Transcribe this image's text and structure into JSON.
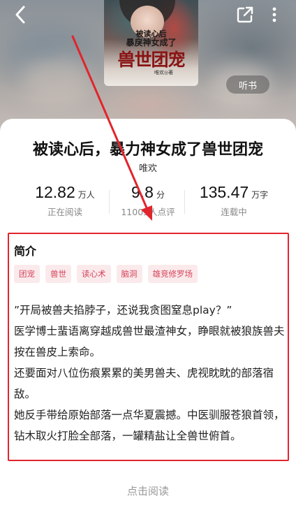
{
  "cover": {
    "subtitle_line1": "被读心后",
    "subtitle_line2": "暴戾神女成了",
    "title_art": "兽世团宠",
    "author_mark": "唯欢◎著"
  },
  "header": {
    "back_icon": "back-chevron-icon",
    "share_icon": "share-icon",
    "more_icon": "more-vertical-icon",
    "listen_label": "听书"
  },
  "book": {
    "title": "被读心后，暴力神女成了兽世团宠",
    "author": "唯欢"
  },
  "stats": [
    {
      "value": "12.82",
      "unit": "万人",
      "label": "正在阅读"
    },
    {
      "value": "9.8",
      "unit": "分",
      "label": "11005人点评"
    },
    {
      "value": "135.47",
      "unit": "万字",
      "label": "连载中"
    }
  ],
  "intro": {
    "heading": "简介",
    "tags": [
      "团宠",
      "兽世",
      "读心术",
      "脑洞",
      "雄竞修罗场"
    ],
    "paragraphs": [
      "”开局被兽夫掐脖子，还说我贪图窒息play？”",
      "医学博士蜚语离穿越成兽世最渣神女，睁眼就被狼族兽夫按在兽皮上索命。",
      "还要面对八位伤痕累累的美男兽夫、虎视眈眈的部落宿敌。",
      "她反手带给原始部落一点华夏震撼。中医驯服苍狼首领，钻木取火打脸全部落，一罐精盐让全兽世俯首。"
    ]
  },
  "footer": {
    "read_label": "点击阅读"
  },
  "colors": {
    "annotation_red": "#e2242c",
    "tag_text": "#d5455b",
    "tag_bg": "#fbeaec"
  }
}
